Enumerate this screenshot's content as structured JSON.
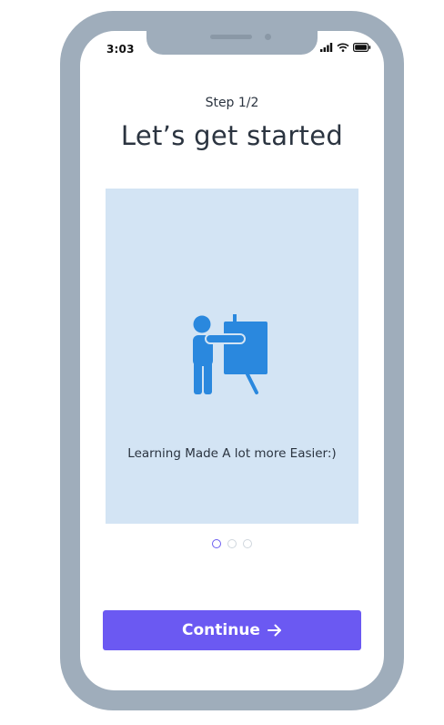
{
  "status_bar": {
    "time": "3:03",
    "icons": [
      "signal-icon",
      "wifi-icon",
      "battery-icon"
    ]
  },
  "onboarding": {
    "step": "Step 1/2",
    "title": "Let’s get started",
    "caption": "Learning Made A lot more Easier:)",
    "illustration": "teacher-at-board-icon",
    "pager": {
      "total": 3,
      "active_index": 0
    },
    "continue_label": "Continue",
    "continue_icon": "arrow-right-icon"
  },
  "colors": {
    "frame": "#9fadbb",
    "card_background": "#d3e4f4",
    "illustration": "#2a88de",
    "accent": "#6b59f2",
    "text": "#2b3440"
  }
}
